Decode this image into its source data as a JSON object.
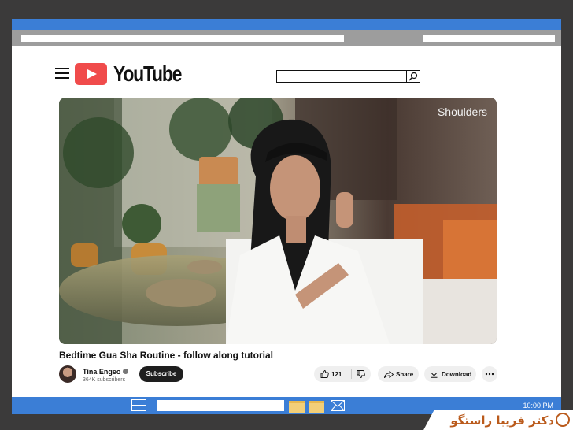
{
  "brand": {
    "logo_text": "YouTube"
  },
  "search": {
    "placeholder": ""
  },
  "video": {
    "overlay_label": "Shoulders"
  },
  "video_info": {
    "title": "Bedtime Gua Sha Routine - follow along tutorial",
    "channel_name": "Tina Engeo",
    "subscribers": "364K subscribers",
    "subscribe_label": "Subscribe",
    "likes": "121",
    "share_label": "Share",
    "download_label": "Download"
  },
  "taskbar": {
    "clock": "10:00 PM"
  },
  "watermark": {
    "text": "دکتر فریبا راستگو"
  },
  "colors": {
    "accent": "#3b7ed6",
    "youtube_red": "#f04b4b",
    "watermark": "#ba5a1b"
  }
}
